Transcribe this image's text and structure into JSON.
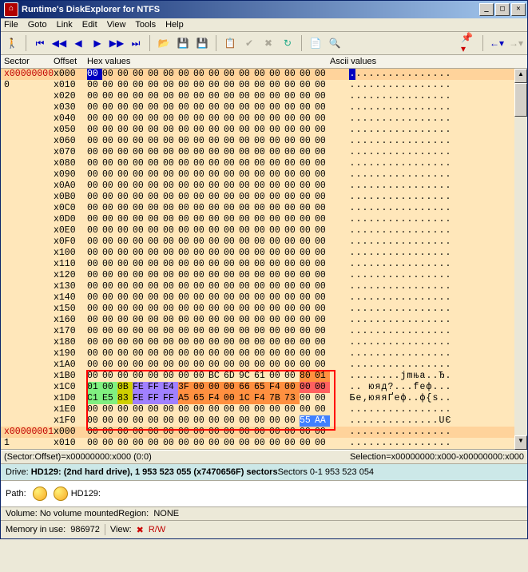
{
  "window": {
    "title": "Runtime's DiskExplorer for NTFS",
    "icon_char": "⌂"
  },
  "menu": [
    "File",
    "Goto",
    "Link",
    "Edit",
    "View",
    "Tools",
    "Help"
  ],
  "columns": {
    "sector": "Sector",
    "offset": "Offset",
    "hex": "Hex values",
    "ascii": "Ascii values"
  },
  "status": {
    "sector_offset": "(Sector:Offset)=x00000000:x000 (0:0)",
    "selection": "Selection=x00000000:x000-x00000000:x000"
  },
  "driveinfo": {
    "label": "Drive:",
    "value": "HD129: (2nd hard drive), 1 953 523 055 (x7470656F) sectors",
    "right": "Sectors 0-1 953 523 054"
  },
  "path": {
    "label": "Path:",
    "value": "HD129:"
  },
  "volume": {
    "label": "Volume:",
    "value": "No volume mounted",
    "region_label": "Region:",
    "region_value": "NONE"
  },
  "bottom": {
    "memory_label": "Memory in use:",
    "memory_value": "986972",
    "view_label": "View:",
    "rw": "R/W"
  },
  "hex": {
    "sectors": [
      {
        "sector": "x00000000",
        "odd": true,
        "red": true,
        "sub": "",
        "offset": "x000",
        "bytes": [
          "00",
          "00",
          "00",
          "00",
          "00",
          "00",
          "00",
          "00",
          "00",
          "00",
          "00",
          "00",
          "00",
          "00",
          "00",
          "00"
        ],
        "ascii": "................",
        "cursor": 0
      },
      {
        "sector": "0",
        "odd": false,
        "red": false,
        "sub": "",
        "offset": "x010",
        "bytes": [
          "00",
          "00",
          "00",
          "00",
          "00",
          "00",
          "00",
          "00",
          "00",
          "00",
          "00",
          "00",
          "00",
          "00",
          "00",
          "00"
        ],
        "ascii": "................"
      },
      {
        "sector": "",
        "odd": false,
        "offset": "x020",
        "bytes": [
          "00",
          "00",
          "00",
          "00",
          "00",
          "00",
          "00",
          "00",
          "00",
          "00",
          "00",
          "00",
          "00",
          "00",
          "00",
          "00"
        ],
        "ascii": "................"
      },
      {
        "sector": "",
        "odd": false,
        "offset": "x030",
        "bytes": [
          "00",
          "00",
          "00",
          "00",
          "00",
          "00",
          "00",
          "00",
          "00",
          "00",
          "00",
          "00",
          "00",
          "00",
          "00",
          "00"
        ],
        "ascii": "................"
      },
      {
        "sector": "",
        "odd": false,
        "offset": "x040",
        "bytes": [
          "00",
          "00",
          "00",
          "00",
          "00",
          "00",
          "00",
          "00",
          "00",
          "00",
          "00",
          "00",
          "00",
          "00",
          "00",
          "00"
        ],
        "ascii": "................"
      },
      {
        "sector": "",
        "odd": false,
        "offset": "x050",
        "bytes": [
          "00",
          "00",
          "00",
          "00",
          "00",
          "00",
          "00",
          "00",
          "00",
          "00",
          "00",
          "00",
          "00",
          "00",
          "00",
          "00"
        ],
        "ascii": "................"
      },
      {
        "sector": "",
        "odd": false,
        "offset": "x060",
        "bytes": [
          "00",
          "00",
          "00",
          "00",
          "00",
          "00",
          "00",
          "00",
          "00",
          "00",
          "00",
          "00",
          "00",
          "00",
          "00",
          "00"
        ],
        "ascii": "................"
      },
      {
        "sector": "",
        "odd": false,
        "offset": "x070",
        "bytes": [
          "00",
          "00",
          "00",
          "00",
          "00",
          "00",
          "00",
          "00",
          "00",
          "00",
          "00",
          "00",
          "00",
          "00",
          "00",
          "00"
        ],
        "ascii": "................"
      },
      {
        "sector": "",
        "odd": false,
        "offset": "x080",
        "bytes": [
          "00",
          "00",
          "00",
          "00",
          "00",
          "00",
          "00",
          "00",
          "00",
          "00",
          "00",
          "00",
          "00",
          "00",
          "00",
          "00"
        ],
        "ascii": "................"
      },
      {
        "sector": "",
        "odd": false,
        "offset": "x090",
        "bytes": [
          "00",
          "00",
          "00",
          "00",
          "00",
          "00",
          "00",
          "00",
          "00",
          "00",
          "00",
          "00",
          "00",
          "00",
          "00",
          "00"
        ],
        "ascii": "................"
      },
      {
        "sector": "",
        "odd": false,
        "offset": "x0A0",
        "bytes": [
          "00",
          "00",
          "00",
          "00",
          "00",
          "00",
          "00",
          "00",
          "00",
          "00",
          "00",
          "00",
          "00",
          "00",
          "00",
          "00"
        ],
        "ascii": "................"
      },
      {
        "sector": "",
        "odd": false,
        "offset": "x0B0",
        "bytes": [
          "00",
          "00",
          "00",
          "00",
          "00",
          "00",
          "00",
          "00",
          "00",
          "00",
          "00",
          "00",
          "00",
          "00",
          "00",
          "00"
        ],
        "ascii": "................"
      },
      {
        "sector": "",
        "odd": false,
        "offset": "x0C0",
        "bytes": [
          "00",
          "00",
          "00",
          "00",
          "00",
          "00",
          "00",
          "00",
          "00",
          "00",
          "00",
          "00",
          "00",
          "00",
          "00",
          "00"
        ],
        "ascii": "................"
      },
      {
        "sector": "",
        "odd": false,
        "offset": "x0D0",
        "bytes": [
          "00",
          "00",
          "00",
          "00",
          "00",
          "00",
          "00",
          "00",
          "00",
          "00",
          "00",
          "00",
          "00",
          "00",
          "00",
          "00"
        ],
        "ascii": "................"
      },
      {
        "sector": "",
        "odd": false,
        "offset": "x0E0",
        "bytes": [
          "00",
          "00",
          "00",
          "00",
          "00",
          "00",
          "00",
          "00",
          "00",
          "00",
          "00",
          "00",
          "00",
          "00",
          "00",
          "00"
        ],
        "ascii": "................"
      },
      {
        "sector": "",
        "odd": false,
        "offset": "x0F0",
        "bytes": [
          "00",
          "00",
          "00",
          "00",
          "00",
          "00",
          "00",
          "00",
          "00",
          "00",
          "00",
          "00",
          "00",
          "00",
          "00",
          "00"
        ],
        "ascii": "................"
      },
      {
        "sector": "",
        "odd": false,
        "offset": "x100",
        "bytes": [
          "00",
          "00",
          "00",
          "00",
          "00",
          "00",
          "00",
          "00",
          "00",
          "00",
          "00",
          "00",
          "00",
          "00",
          "00",
          "00"
        ],
        "ascii": "................"
      },
      {
        "sector": "",
        "odd": false,
        "offset": "x110",
        "bytes": [
          "00",
          "00",
          "00",
          "00",
          "00",
          "00",
          "00",
          "00",
          "00",
          "00",
          "00",
          "00",
          "00",
          "00",
          "00",
          "00"
        ],
        "ascii": "................"
      },
      {
        "sector": "",
        "odd": false,
        "offset": "x120",
        "bytes": [
          "00",
          "00",
          "00",
          "00",
          "00",
          "00",
          "00",
          "00",
          "00",
          "00",
          "00",
          "00",
          "00",
          "00",
          "00",
          "00"
        ],
        "ascii": "................"
      },
      {
        "sector": "",
        "odd": false,
        "offset": "x130",
        "bytes": [
          "00",
          "00",
          "00",
          "00",
          "00",
          "00",
          "00",
          "00",
          "00",
          "00",
          "00",
          "00",
          "00",
          "00",
          "00",
          "00"
        ],
        "ascii": "................"
      },
      {
        "sector": "",
        "odd": false,
        "offset": "x140",
        "bytes": [
          "00",
          "00",
          "00",
          "00",
          "00",
          "00",
          "00",
          "00",
          "00",
          "00",
          "00",
          "00",
          "00",
          "00",
          "00",
          "00"
        ],
        "ascii": "................"
      },
      {
        "sector": "",
        "odd": false,
        "offset": "x150",
        "bytes": [
          "00",
          "00",
          "00",
          "00",
          "00",
          "00",
          "00",
          "00",
          "00",
          "00",
          "00",
          "00",
          "00",
          "00",
          "00",
          "00"
        ],
        "ascii": "................"
      },
      {
        "sector": "",
        "odd": false,
        "offset": "x160",
        "bytes": [
          "00",
          "00",
          "00",
          "00",
          "00",
          "00",
          "00",
          "00",
          "00",
          "00",
          "00",
          "00",
          "00",
          "00",
          "00",
          "00"
        ],
        "ascii": "................"
      },
      {
        "sector": "",
        "odd": false,
        "offset": "x170",
        "bytes": [
          "00",
          "00",
          "00",
          "00",
          "00",
          "00",
          "00",
          "00",
          "00",
          "00",
          "00",
          "00",
          "00",
          "00",
          "00",
          "00"
        ],
        "ascii": "................"
      },
      {
        "sector": "",
        "odd": false,
        "offset": "x180",
        "bytes": [
          "00",
          "00",
          "00",
          "00",
          "00",
          "00",
          "00",
          "00",
          "00",
          "00",
          "00",
          "00",
          "00",
          "00",
          "00",
          "00"
        ],
        "ascii": "................"
      },
      {
        "sector": "",
        "odd": false,
        "offset": "x190",
        "bytes": [
          "00",
          "00",
          "00",
          "00",
          "00",
          "00",
          "00",
          "00",
          "00",
          "00",
          "00",
          "00",
          "00",
          "00",
          "00",
          "00"
        ],
        "ascii": "................"
      },
      {
        "sector": "",
        "odd": false,
        "offset": "x1A0",
        "bytes": [
          "00",
          "00",
          "00",
          "00",
          "00",
          "00",
          "00",
          "00",
          "00",
          "00",
          "00",
          "00",
          "00",
          "00",
          "00",
          "00"
        ],
        "ascii": "................"
      },
      {
        "sector": "",
        "odd": false,
        "offset": "x1B0",
        "bytes": [
          "00",
          "00",
          "00",
          "00",
          "00",
          "00",
          "00",
          "00",
          "BC",
          "6D",
          "9C",
          "61",
          "00",
          "00",
          "80",
          "01"
        ],
        "ascii": "........јmњa..Ђ.",
        "hl": {
          "14": "a",
          "15": "a"
        }
      },
      {
        "sector": "",
        "odd": false,
        "offset": "x1C0",
        "bytes": [
          "01",
          "00",
          "0B",
          "FE",
          "FF",
          "E4",
          "3F",
          "00",
          "00",
          "00",
          "66",
          "65",
          "F4",
          "00",
          "00",
          "00"
        ],
        "ascii": ".. юяд?...feф...",
        "hl": {
          "0": "c",
          "1": "c",
          "2": "f",
          "3": "b",
          "4": "b",
          "5": "b",
          "6": "a",
          "7": "a",
          "8": "a",
          "9": "a",
          "10": "a",
          "11": "a",
          "12": "a",
          "13": "a",
          "14": "d",
          "15": "d"
        }
      },
      {
        "sector": "",
        "odd": false,
        "offset": "x1D0",
        "bytes": [
          "C1",
          "E5",
          "83",
          "FE",
          "FF",
          "FF",
          "A5",
          "65",
          "F4",
          "00",
          "1C",
          "F4",
          "7B",
          "73",
          "00",
          "00"
        ],
        "ascii": "Бе‚юяяҐeф..ф{s..",
        "hl": {
          "0": "c",
          "1": "c",
          "2": "f",
          "3": "b",
          "4": "b",
          "5": "b",
          "6": "a",
          "7": "a",
          "8": "a",
          "9": "a",
          "10": "a",
          "11": "a",
          "12": "a",
          "13": "a"
        }
      },
      {
        "sector": "",
        "odd": false,
        "offset": "x1E0",
        "bytes": [
          "00",
          "00",
          "00",
          "00",
          "00",
          "00",
          "00",
          "00",
          "00",
          "00",
          "00",
          "00",
          "00",
          "00",
          "00",
          "00"
        ],
        "ascii": "................"
      },
      {
        "sector": "",
        "odd": false,
        "offset": "x1F0",
        "bytes": [
          "00",
          "00",
          "00",
          "00",
          "00",
          "00",
          "00",
          "00",
          "00",
          "00",
          "00",
          "00",
          "00",
          "00",
          "55",
          "AA"
        ],
        "ascii": "..............UЄ",
        "hl": {
          "14": "e",
          "15": "e"
        }
      },
      {
        "sector": "x00000001",
        "odd": true,
        "red": true,
        "offset": "x000",
        "bytes": [
          "00",
          "00",
          "00",
          "00",
          "00",
          "00",
          "00",
          "00",
          "00",
          "00",
          "00",
          "00",
          "00",
          "00",
          "00",
          "00"
        ],
        "ascii": "................"
      },
      {
        "sector": "1",
        "odd": false,
        "offset": "x010",
        "bytes": [
          "00",
          "00",
          "00",
          "00",
          "00",
          "00",
          "00",
          "00",
          "00",
          "00",
          "00",
          "00",
          "00",
          "00",
          "00",
          "00"
        ],
        "ascii": "................"
      }
    ]
  }
}
